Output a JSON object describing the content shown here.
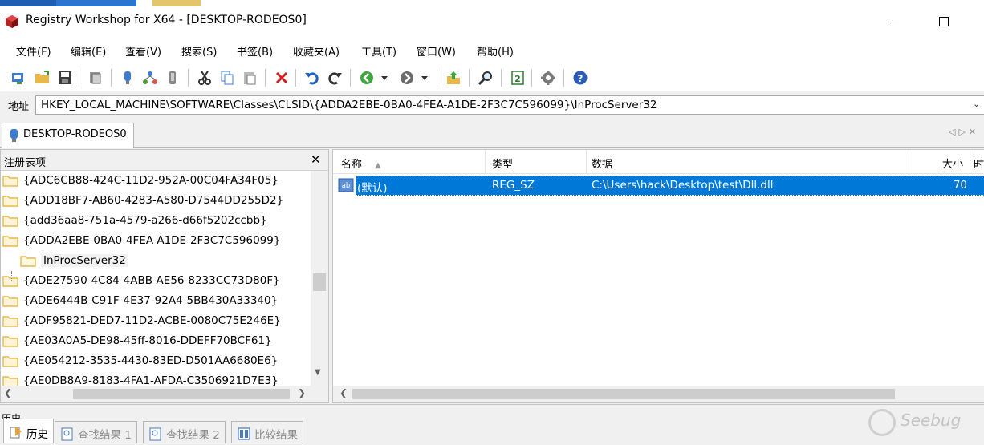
{
  "window": {
    "title": "Registry Workshop for X64 - [DESKTOP-RODEOS0]"
  },
  "menu": [
    {
      "label": "文件(F)"
    },
    {
      "label": "编辑(E)"
    },
    {
      "label": "查看(V)"
    },
    {
      "label": "搜索(S)"
    },
    {
      "label": "书签(B)"
    },
    {
      "label": "收藏夹(A)"
    },
    {
      "label": "工具(T)"
    },
    {
      "label": "窗口(W)"
    },
    {
      "label": "帮助(H)"
    }
  ],
  "toolbar": {
    "icons": [
      "connect-registry-icon",
      "open-icon",
      "save-icon",
      "export-icon",
      "new-key-icon",
      "network-icon",
      "bookmark-icon",
      "cut-icon",
      "copy-icon",
      "paste-icon",
      "delete-icon",
      "undo-icon",
      "redo-icon",
      "back-icon",
      "back-dropdown-icon",
      "forward-icon",
      "forward-dropdown-icon",
      "up-level-icon",
      "find-icon",
      "refresh-icon",
      "settings-icon",
      "help-icon"
    ]
  },
  "address": {
    "label": "地址",
    "value": "HKEY_LOCAL_MACHINE\\SOFTWARE\\Classes\\CLSID\\{ADDA2EBE-0BA0-4FEA-A1DE-2F3C7C596099}\\InProcServer32"
  },
  "machine_tab": {
    "label": "DESKTOP-RODEOS0"
  },
  "tree_panel": {
    "title": "注册表项",
    "items": [
      {
        "label": "{ADC6CB88-424C-11D2-952A-00C04FA34F05}",
        "level": 0
      },
      {
        "label": "{ADD18BF7-AB60-4283-A580-D7544DD255D2}",
        "level": 0
      },
      {
        "label": "{add36aa8-751a-4579-a266-d66f5202ccbb}",
        "level": 0
      },
      {
        "label": "{ADDA2EBE-0BA0-4FEA-A1DE-2F3C7C596099}",
        "level": 0
      },
      {
        "label": "InProcServer32",
        "level": 1
      },
      {
        "label": "{ADE27590-4C84-4ABB-AE56-8233CC73D80F}",
        "level": 0
      },
      {
        "label": "{ADE6444B-C91F-4E37-92A4-5BB430A33340}",
        "level": 0
      },
      {
        "label": "{ADF95821-DED7-11D2-ACBE-0080C75E246E}",
        "level": 0
      },
      {
        "label": "{AE03A0A5-DE98-45ff-8016-DDEFF70BCF61}",
        "level": 0
      },
      {
        "label": "{AE054212-3535-4430-83ED-D501AA6680E6}",
        "level": 0
      },
      {
        "label": "{AE0DB8A9-8183-4FA1-AFDA-C3506921D7E3}",
        "level": 0
      }
    ]
  },
  "values_panel": {
    "columns": {
      "name": "名称",
      "type": "类型",
      "data": "数据",
      "size": "大小",
      "time": "时"
    },
    "rows": [
      {
        "name": "(默认)",
        "type": "REG_SZ",
        "data": "C:\\Users\\hack\\Desktop\\test\\Dll.dll",
        "size": "70"
      }
    ]
  },
  "bottom": {
    "history_label": "历史",
    "tabs": [
      {
        "label": "历史",
        "active": true
      },
      {
        "label": "查找结果 1",
        "active": false
      },
      {
        "label": "查找结果 2",
        "active": false
      },
      {
        "label": "比较结果",
        "active": false
      }
    ]
  },
  "watermark": {
    "text": "Seebug"
  },
  "colors": {
    "selection": "#0078d7",
    "folder": "#e8b94a"
  }
}
